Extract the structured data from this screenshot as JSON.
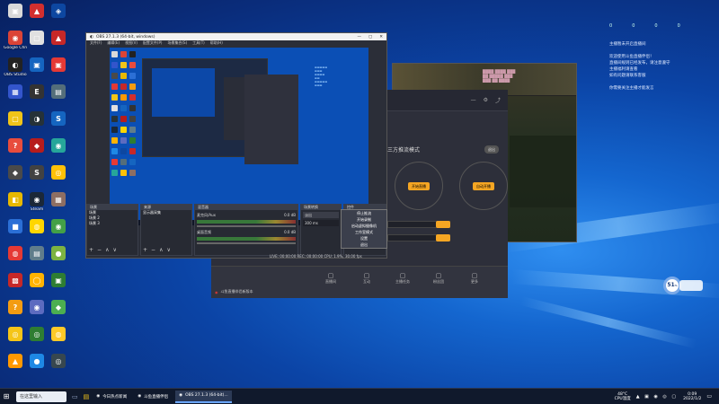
{
  "desktop": {
    "icons": [
      {
        "label": "",
        "color": "#d9d9d9",
        "glyph": "▣"
      },
      {
        "label": "Google Chrome",
        "color": "#db4437",
        "glyph": "◉"
      },
      {
        "label": "OBS Studio",
        "color": "#222222",
        "glyph": "◐"
      },
      {
        "label": "",
        "color": "#3355cc",
        "glyph": "▦"
      },
      {
        "label": "",
        "color": "#f0c419",
        "glyph": "▢"
      },
      {
        "label": "",
        "color": "#e84c3d",
        "glyph": "?"
      },
      {
        "label": "",
        "color": "#4a4a4a",
        "glyph": "◆"
      },
      {
        "label": "",
        "color": "#e6b800",
        "glyph": "◧"
      },
      {
        "label": "",
        "color": "#2b6fd6",
        "glyph": "■"
      },
      {
        "label": "",
        "color": "#e53935",
        "glyph": "◍"
      },
      {
        "label": "",
        "color": "#c62828",
        "glyph": "▩"
      },
      {
        "label": "",
        "color": "#f39c12",
        "glyph": "?"
      },
      {
        "label": "",
        "color": "#f5c518",
        "glyph": "◎"
      },
      {
        "label": "",
        "color": "#ff9800",
        "glyph": "▲"
      },
      {
        "label": "",
        "color": "#d32f2f",
        "glyph": "▲"
      },
      {
        "label": "",
        "color": "#e0e0e0",
        "glyph": "▢"
      },
      {
        "label": "",
        "color": "#1565c0",
        "glyph": "▣"
      },
      {
        "label": "",
        "color": "#333333",
        "glyph": "E"
      },
      {
        "label": "",
        "color": "#263238",
        "glyph": "◑"
      },
      {
        "label": "",
        "color": "#b71c1c",
        "glyph": "◆"
      },
      {
        "label": "",
        "color": "#424242",
        "glyph": "S"
      },
      {
        "label": "Steam",
        "color": "#1b2838",
        "glyph": "◉"
      },
      {
        "label": "",
        "color": "#ffd600",
        "glyph": "◍"
      },
      {
        "label": "",
        "color": "#607d8b",
        "glyph": "▤"
      },
      {
        "label": "",
        "color": "#ffb300",
        "glyph": "◯"
      },
      {
        "label": "",
        "color": "#5c6bc0",
        "glyph": "◉"
      },
      {
        "label": "",
        "color": "#2e7d32",
        "glyph": "◎"
      },
      {
        "label": "",
        "color": "#1e88e5",
        "glyph": "●"
      },
      {
        "label": "",
        "color": "#0d47a1",
        "glyph": "◈"
      },
      {
        "label": "",
        "color": "#c62828",
        "glyph": "▲"
      },
      {
        "label": "",
        "color": "#e53935",
        "glyph": "▣"
      },
      {
        "label": "",
        "color": "#546e7a",
        "glyph": "▤"
      },
      {
        "label": "",
        "color": "#1565c0",
        "glyph": "S"
      },
      {
        "label": "",
        "color": "#26a69a",
        "glyph": "◉"
      },
      {
        "label": "",
        "color": "#ffc107",
        "glyph": "◎"
      },
      {
        "label": "",
        "color": "#8d6e63",
        "glyph": "▦"
      },
      {
        "label": "",
        "color": "#43a047",
        "glyph": "◉"
      },
      {
        "label": "",
        "color": "#7cb342",
        "glyph": "●"
      },
      {
        "label": "",
        "color": "#2e7d32",
        "glyph": "▣"
      },
      {
        "label": "",
        "color": "#4caf50",
        "glyph": "◆"
      },
      {
        "label": "",
        "color": "#ffca28",
        "glyph": "◍"
      },
      {
        "label": "",
        "color": "#37474f",
        "glyph": "◎"
      }
    ]
  },
  "obs": {
    "title": "OBS 27.1.3 (64-bit, windows)",
    "menus": [
      "文件(F)",
      "编辑(E)",
      "视图(V)",
      "配置文件(P)",
      "场景集合(S)",
      "工具(T)",
      "帮助(H)"
    ],
    "docks": {
      "scenes": "场景",
      "sources": "来源",
      "mixer": "混音器",
      "transitions": "场景转换",
      "controls": "控件"
    },
    "scene_items": [
      "场景",
      "场景 2",
      "场景 3"
    ],
    "source_items": [
      "显示器采集"
    ],
    "mixer_rows": [
      {
        "label": "麦克风/Aux",
        "db": "0.0 dB"
      },
      {
        "label": "桌面音频",
        "db": "0.0 dB"
      }
    ],
    "transition_value": "淡出",
    "duration": "300 ms",
    "context_menu": [
      "停止推流",
      "开始录制",
      "启动虚拟摄像机",
      "工作室模式",
      "设置",
      "退出"
    ],
    "status": "LIVE: 00:00:00   REC: 00:00:00   CPU: 1.9%, 30.00 fps"
  },
  "live": {
    "mode_label": "三方推流模式",
    "btn_primary": "开始直播",
    "btn_secondary": "自动开播",
    "exit": "退出",
    "bottom_labels": [
      "直播间",
      "互动",
      "主播任务",
      "粉丝团",
      "更多"
    ],
    "notice": "斗鱼直播伴侣新版本"
  },
  "widget": {
    "stats": [
      "0",
      "0",
      "0",
      "0"
    ],
    "lines": [
      "主播暂未开启直播间",
      "",
      "欢迎使用斗鱼直播伴侣！",
      "直播间规则已经发布，请注意遵守",
      "主播福利请查看",
      "如有问题请联系客服",
      "",
      "你需要关注主播才能发言"
    ]
  },
  "gauge": {
    "value": "51",
    "unit": "%"
  },
  "taskbar": {
    "search": "在这里输入",
    "apps": [
      {
        "label": "今日热点新闻",
        "active": false
      },
      {
        "label": "斗鱼直播伴侣",
        "active": false
      },
      {
        "label": "OBS 27.1.3 (64-bit)...",
        "active": true
      }
    ],
    "tray": "48°C\nCPU温度",
    "time": "0:09",
    "date": "2022/1/2"
  },
  "colors": {
    "accent": "#f5a623",
    "obs_bg": "#2b2e38",
    "desktop": "#0b44a6"
  }
}
